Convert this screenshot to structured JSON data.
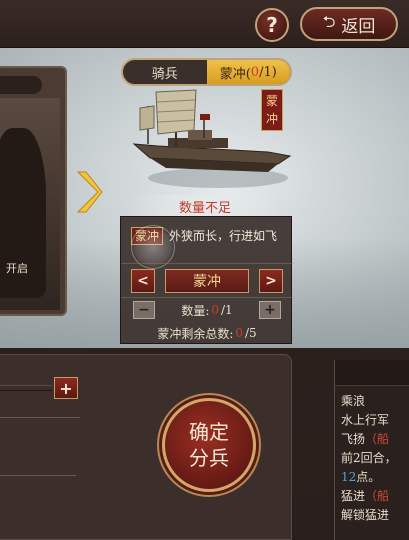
{
  "topbar": {
    "help_label": "?",
    "back_label": "返回",
    "back_arrow": "⮌"
  },
  "left_panel": {
    "lock_text": "开启"
  },
  "tabs": [
    {
      "label": "骑兵"
    },
    {
      "label_prefix": "蒙冲(",
      "count": "0",
      "label_suffix": "/1)"
    }
  ],
  "ship": {
    "seal_text": "蒙冲",
    "warning": "数量不足"
  },
  "info": {
    "seal": "蒙冲",
    "description": "外狭而长，行进如飞",
    "prev_arrow": "<",
    "next_arrow": ">",
    "selected_unit": "蒙冲",
    "minus": "−",
    "plus": "+",
    "quantity_label": "数量:",
    "quantity_current": "0",
    "quantity_max": "/1",
    "remaining_label": "蒙冲剩余总数:",
    "remaining_current": "0",
    "remaining_total": "/5"
  },
  "bottom_left": {
    "plus": "+"
  },
  "confirm": {
    "line1": "确定",
    "line2": "分兵"
  },
  "right_panel": {
    "line1": "乘浪",
    "line2": "水上行军",
    "line3_text": "飞扬",
    "line3_paren": "（船",
    "line4": "前2回合，",
    "line5_num": "12",
    "line5_text": "点。",
    "line6_text": "猛进",
    "line6_paren": "（船",
    "line7": "解锁猛进"
  }
}
